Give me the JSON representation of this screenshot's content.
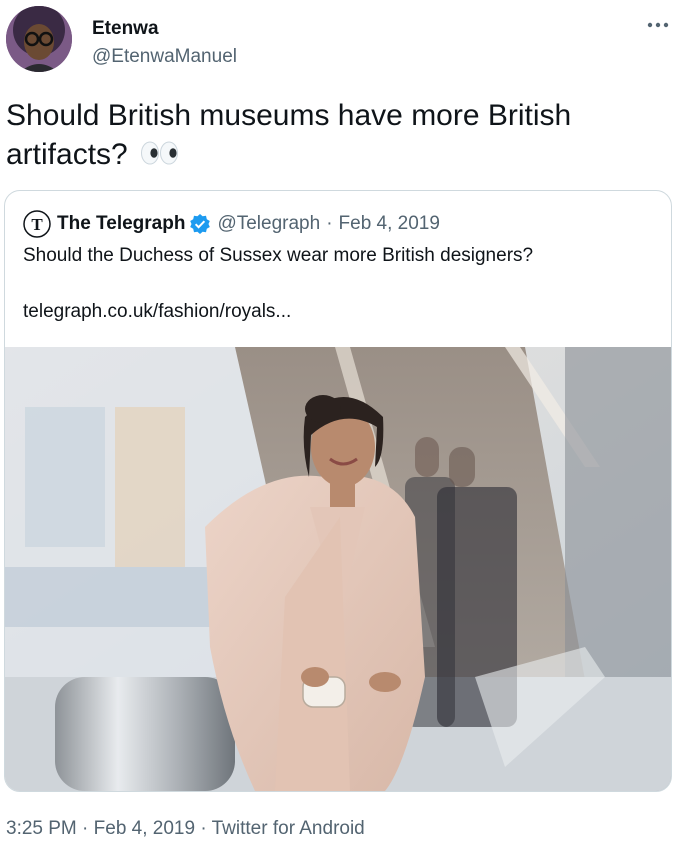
{
  "tweet": {
    "author_name": "Etenwa",
    "author_handle": "@EtenwaManuel",
    "text": "Should British museums have more British artifacts?",
    "emoji": "eyes-emoji",
    "footer": {
      "time": "3:25 PM",
      "separator": "·",
      "date": "Feb 4, 2019",
      "source": "Twitter for Android"
    }
  },
  "quoted_tweet": {
    "author_name": "The Telegraph",
    "author_handle": "@Telegraph",
    "separator": "·",
    "date": "Feb 4, 2019",
    "text": "Should the Duchess of Sussex wear more British designers?",
    "link": "telegraph.co.uk/fashion/royals...",
    "verified": true
  },
  "colors": {
    "primary_text": "#0f1419",
    "secondary_text": "#536471",
    "verified_blue": "#1d9bf0",
    "border": "#cfd9de"
  },
  "icons": [
    "more-icon",
    "verified-badge-icon",
    "telegraph-logo-icon",
    "eyes-emoji"
  ]
}
